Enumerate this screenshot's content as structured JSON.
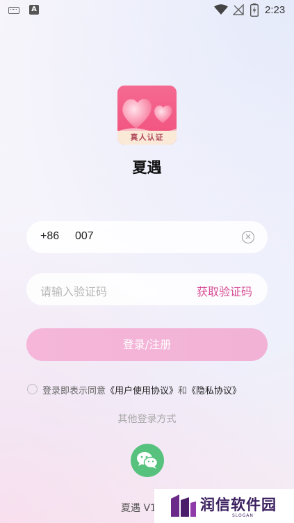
{
  "status_bar": {
    "time": "2:23",
    "input_icon": "A"
  },
  "app": {
    "name": "夏遇",
    "logo_badge": "真人认证"
  },
  "login_form": {
    "country_code": "+86",
    "phone_value": "007",
    "code_placeholder": "请输入验证码",
    "get_code_label": "获取验证码",
    "submit_label": "登录/注册"
  },
  "agreement": {
    "prefix": "登录即表示同意",
    "user_agreement": "《用户使用协议》",
    "conjunction": "和",
    "privacy_policy": "《隐私协议》"
  },
  "other_login": {
    "title": "其他登录方式",
    "methods": [
      "wechat-icon"
    ]
  },
  "footer": {
    "version": "夏遇 V1"
  },
  "watermark": {
    "text": "润信软件园",
    "slogan": "SLOGAN"
  },
  "colors": {
    "accent": "#d84f95",
    "button": "#f3b4d8",
    "wechat": "#56c27e"
  }
}
